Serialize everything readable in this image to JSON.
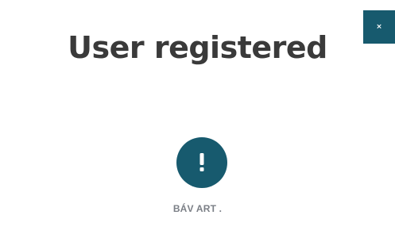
{
  "dialog": {
    "title": "User registered",
    "close_label": "×",
    "alert_icon": "exclamation-icon",
    "message": "BÁV ART ."
  },
  "colors": {
    "accent": "#175a6e",
    "title_text": "#3a3a3a",
    "message_text": "#7b7f86",
    "background": "#ffffff"
  }
}
